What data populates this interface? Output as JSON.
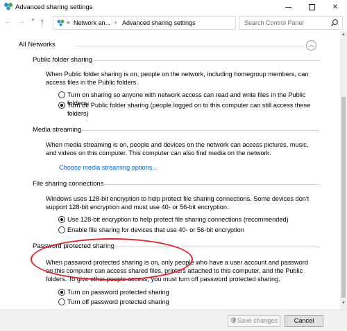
{
  "window": {
    "title": "Advanced sharing settings",
    "controls": {
      "minimize": "minimize",
      "maximize": "maximize",
      "close": "✕"
    }
  },
  "address_bar": {
    "prefix": "«",
    "segments": [
      "Network an...",
      "Advanced sharing settings"
    ],
    "separator": "›",
    "search_placeholder": "Search Control Panel"
  },
  "network": {
    "header": "All Networks",
    "collapse_symbol": "︿"
  },
  "sections": {
    "public_folder": {
      "title": "Public folder sharing",
      "description": "When Public folder sharing is on, people on the network, including homegroup members, can access files in the Public folders.",
      "options": [
        {
          "label": "Turn on sharing so anyone with network access can read and write files in the Public folders",
          "selected": false
        },
        {
          "label": "Turn off Public folder sharing (people logged on to this computer can still access these folders)",
          "selected": true
        }
      ]
    },
    "media": {
      "title": "Media streaming",
      "description": "When media streaming is on, people and devices on the network can access pictures, music, and videos on this computer. This computer can also find media on the network.",
      "link": "Choose media streaming options..."
    },
    "file_sharing": {
      "title": "File sharing connections",
      "description": "Windows uses 128-bit encryption to help protect file sharing connections. Some devices don't support 128-bit encryption and must use 40- or 56-bit encryption.",
      "options": [
        {
          "label": "Use 128-bit encryption to help protect file sharing connections (recommended)",
          "selected": true
        },
        {
          "label": "Enable file sharing for devices that use 40- or 56-bit encryption",
          "selected": false
        }
      ]
    },
    "password": {
      "title": "Password protected sharing",
      "description": "When password protected sharing is on, only people who have a user account and password on this computer can access shared files, printers attached to this computer, and the Public folders. To give other people access, you must turn off password protected sharing.",
      "options": [
        {
          "label": "Turn on password protected sharing",
          "selected": true
        },
        {
          "label": "Turn off password protected sharing",
          "selected": false
        }
      ]
    }
  },
  "buttons": {
    "save": "Save changes",
    "cancel": "Cancel"
  },
  "colors": {
    "link": "#0066cc",
    "annotation": "#e0222b"
  }
}
